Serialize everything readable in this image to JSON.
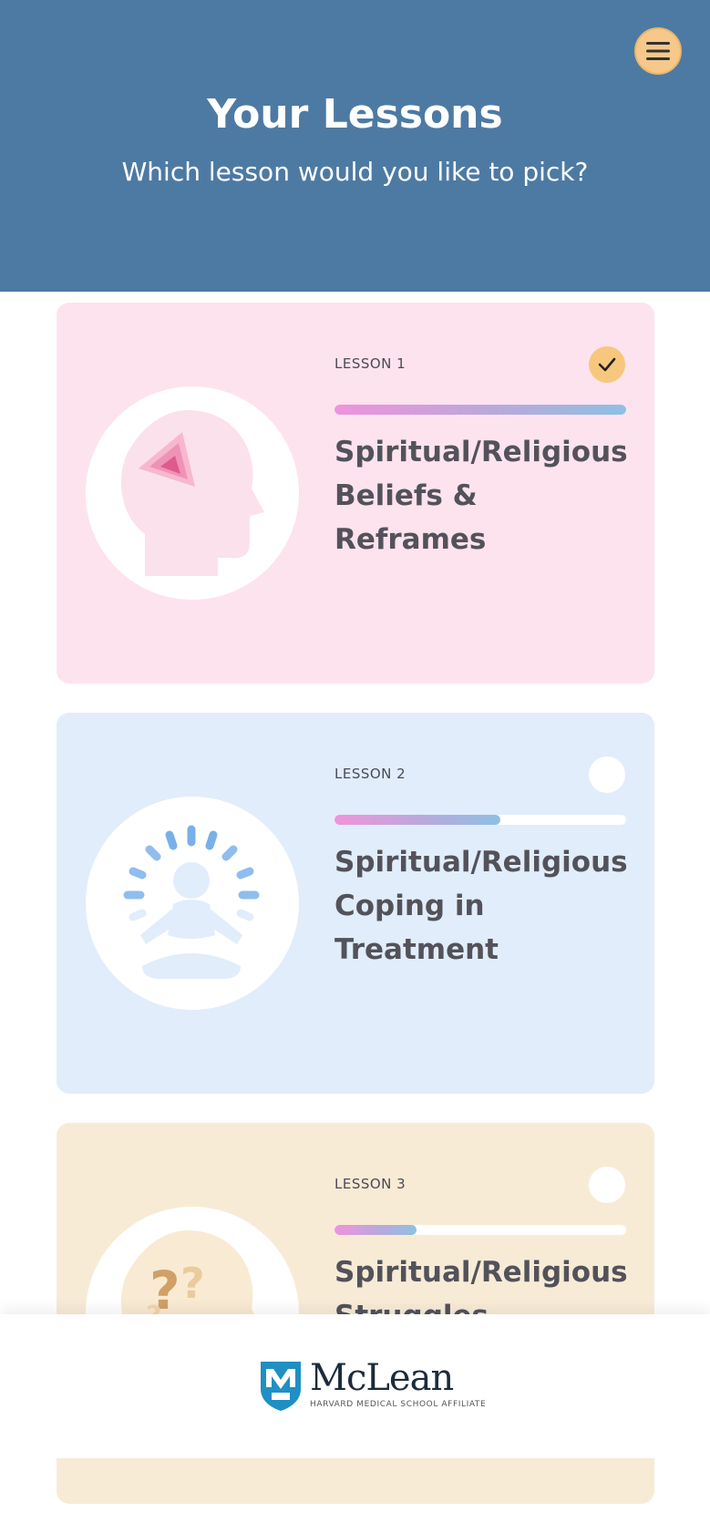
{
  "header": {
    "title": "Your Lessons",
    "subtitle": "Which lesson would you like to pick?",
    "menu_icon": "hamburger-menu-icon",
    "background": "#4d7aa3"
  },
  "lessons": [
    {
      "label": "LESSON 1",
      "title": "Spiritual/Religious Beliefs & Reframes",
      "progress": 1.0,
      "completed": true,
      "status_icon": "checkmark-icon",
      "illustration_icon": "head-with-triangle-icon",
      "color": "#fde3ee"
    },
    {
      "label": "LESSON 2",
      "title": "Spiritual/Religious Coping in Treatment",
      "progress": 0.57,
      "completed": false,
      "status_icon": "empty-circle-icon",
      "illustration_icon": "meditating-person-icon",
      "color": "#e1edfa"
    },
    {
      "label": "LESSON 3",
      "title": "Spiritual/Religious Struggles",
      "progress": 0.28,
      "completed": false,
      "status_icon": "empty-circle-icon",
      "illustration_icon": "head-with-question-marks-icon",
      "color": "#f8ebd6"
    }
  ],
  "footer": {
    "logo_name": "McLean",
    "logo_subtitle": "HARVARD MEDICAL SCHOOL AFFILIATE",
    "logo_icon": "mclean-shield-logo-icon"
  }
}
